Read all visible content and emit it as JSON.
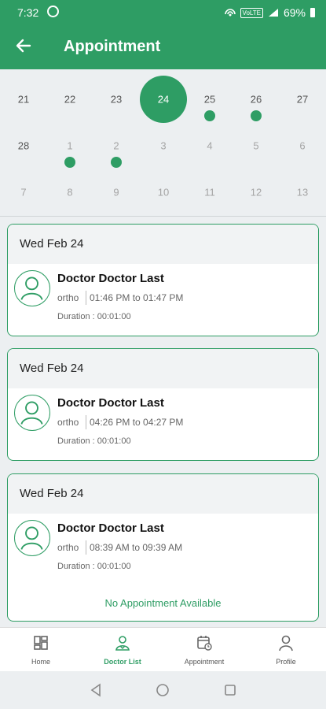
{
  "status_bar": {
    "time": "7:32",
    "network_badge": "VoLTE",
    "battery": "69%"
  },
  "app_bar": {
    "title": "Appointment",
    "back_icon": "arrow-left-icon"
  },
  "calendar": {
    "selected": "24",
    "rows": [
      [
        {
          "d": "21",
          "state": "normal",
          "dot": false
        },
        {
          "d": "22",
          "state": "normal",
          "dot": false
        },
        {
          "d": "23",
          "state": "normal",
          "dot": false
        },
        {
          "d": "24",
          "state": "selected",
          "dot": false
        },
        {
          "d": "25",
          "state": "normal",
          "dot": true
        },
        {
          "d": "26",
          "state": "normal",
          "dot": true
        },
        {
          "d": "27",
          "state": "normal",
          "dot": false
        }
      ],
      [
        {
          "d": "28",
          "state": "normal",
          "dot": false
        },
        {
          "d": "1",
          "state": "muted",
          "dot": true
        },
        {
          "d": "2",
          "state": "muted",
          "dot": true
        },
        {
          "d": "3",
          "state": "muted",
          "dot": false
        },
        {
          "d": "4",
          "state": "muted",
          "dot": false
        },
        {
          "d": "5",
          "state": "muted",
          "dot": false
        },
        {
          "d": "6",
          "state": "muted",
          "dot": false
        }
      ],
      [
        {
          "d": "7",
          "state": "muted",
          "dot": false
        },
        {
          "d": "8",
          "state": "muted",
          "dot": false
        },
        {
          "d": "9",
          "state": "muted",
          "dot": false
        },
        {
          "d": "10",
          "state": "muted",
          "dot": false
        },
        {
          "d": "11",
          "state": "muted",
          "dot": false
        },
        {
          "d": "12",
          "state": "muted",
          "dot": false
        },
        {
          "d": "13",
          "state": "muted",
          "dot": false
        }
      ]
    ]
  },
  "appointments": [
    {
      "date": "Wed Feb 24",
      "doctor": "Doctor Doctor Last",
      "specialty": "ortho",
      "time": "01:46 PM to 01:47 PM",
      "duration": "Duration : 00:01:00"
    },
    {
      "date": "Wed Feb 24",
      "doctor": "Doctor Doctor Last",
      "specialty": "ortho",
      "time": "04:26 PM to 04:27 PM",
      "duration": "Duration : 00:01:00"
    },
    {
      "date": "Wed Feb 24",
      "doctor": "Doctor Doctor Last",
      "specialty": "ortho",
      "time": "08:39 AM to 09:39 AM",
      "duration": "Duration : 00:01:00"
    }
  ],
  "no_appointment_text": "No Appointment Available",
  "bottom_nav": [
    {
      "label": "Home",
      "icon": "dashboard-icon",
      "active": false
    },
    {
      "label": "Doctor List",
      "icon": "doctor-icon",
      "active": true
    },
    {
      "label": "Appointment",
      "icon": "calendar-clock-icon",
      "active": false
    },
    {
      "label": "Profile",
      "icon": "person-icon",
      "active": false
    }
  ],
  "colors": {
    "primary": "#2e9d64",
    "background": "#eceff1",
    "muted": "#a5a5a5"
  }
}
